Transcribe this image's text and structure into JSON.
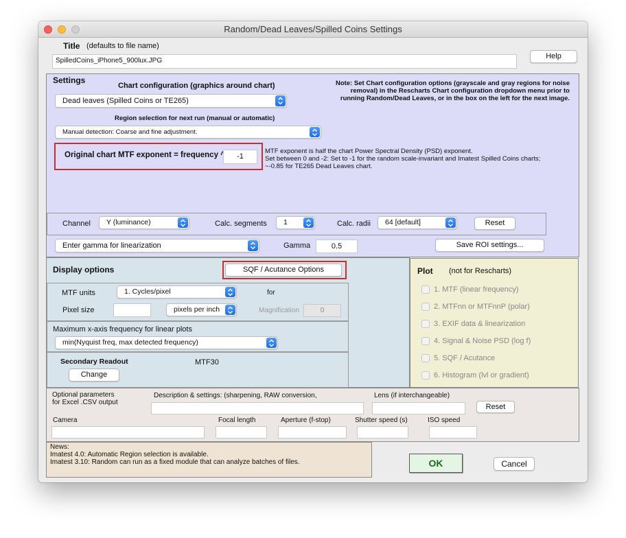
{
  "window": {
    "title": "Random/Dead Leaves/Spilled Coins Settings"
  },
  "title_row": {
    "label": "Title",
    "hint": "(defaults to file name)",
    "value": "SpilledCoins_iPhone5_900lux.JPG",
    "help_label": "Help"
  },
  "settings": {
    "heading": "Settings",
    "chart_config_label": "Chart configuration (graphics around chart)",
    "chart_config_value": "Dead leaves (Spilled Coins or TE265)",
    "note": "Note: Set Chart configuration options (grayscale and gray regions for noise removal) in the Rescharts Chart configuration dropdown menu prior to running Random/Dead Leaves, or in the box on the left for the next image.",
    "region_label": "Region selection for next run (manual or automatic)",
    "region_value": "Manual detection:  Coarse and fine adjustment.",
    "mtf_exp_label": "Original chart MTF exponent = frequency ^",
    "mtf_exp_value": "-1",
    "mtf_exp_help": [
      "MTF exponent is half the chart Power Spectral Density (PSD) exponent.",
      "Set between 0 and -2:  Set to -1 for the random scale-invariant and Imatest Spilled Coins charts;",
      "~-0.85 for TE265 Dead Leaves chart."
    ],
    "channel_label": "Channel",
    "channel_value": "Y (luminance)",
    "calc_segments_label": "Calc. segments",
    "calc_segments_value": "1",
    "calc_radii_label": "Calc. radii",
    "calc_radii_value": "64   [default]",
    "reset_label": "Reset",
    "gamma_select_value": "Enter gamma for linearization",
    "gamma_label": "Gamma",
    "gamma_value": "0.5",
    "save_roi_label": "Save ROI settings..."
  },
  "display": {
    "heading": "Display options",
    "sqf_button": "SQF / Acutance Options",
    "mtf_units_label": "MTF units",
    "mtf_units_value": "1. Cycles/pixel",
    "for_label": "for",
    "pixel_size_label": "Pixel size",
    "pixel_size_value": "",
    "pixel_unit_value": "pixels per inch",
    "magnification_label": "Magnification",
    "magnification_value": "0",
    "max_freq_label": "Maximum x-axis frequency for linear plots",
    "max_freq_value": "min(Nyquist freq, max detected frequency)",
    "secondary_label": "Secondary Readout",
    "secondary_value": "MTF30",
    "change_label": "Change"
  },
  "plot": {
    "heading": "Plot",
    "note": "(not for Rescharts)",
    "items": [
      "1. MTF (linear frequency)",
      "2. MTFnn or MTFnnP (polar)",
      "3. EXIF data & linearization",
      "4. Signal & Noise PSD (log f)",
      "5. SQF / Acutance",
      "6. Histogram (lvl or gradient)"
    ]
  },
  "params": {
    "optional_label_1": "Optional parameters",
    "optional_label_2": "for Excel .CSV output",
    "description_label": "Description & settings:  (sharpening, RAW conversion,",
    "lens_label": "Lens (if interchangeable)",
    "reset_label": "Reset",
    "camera_label": "Camera",
    "focal_label": "Focal length",
    "aperture_label": "Aperture (f-stop)",
    "shutter_label": "Shutter speed (s)",
    "iso_label": "ISO speed"
  },
  "news": {
    "heading": "News:",
    "line1": "Imatest 4.0: Automatic Region selection is available.",
    "line2": "Imatest 3.10: Random can run as a fixed module that can analyze batches of files."
  },
  "footer": {
    "ok_label": "OK",
    "cancel_label": "Cancel"
  },
  "colors": {
    "settings_bg": "#dcdcf8",
    "display_bg": "#d8e4ec",
    "plot_bg": "#f1efd4",
    "news_bg": "#efe3d3",
    "ok_bg": "#e4f5e4",
    "highlight_red": "#d42a2a"
  }
}
